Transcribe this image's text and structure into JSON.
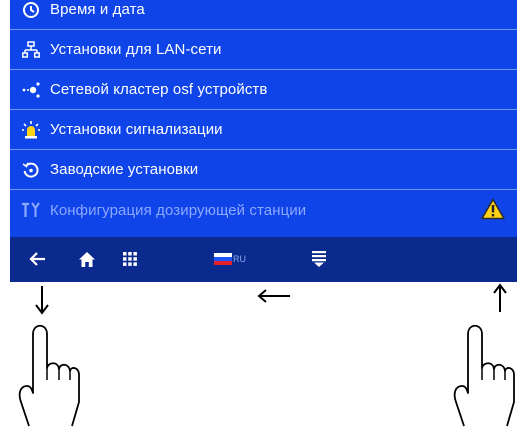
{
  "menu": {
    "items": [
      {
        "label": "Время и дата",
        "icon": "clock-icon"
      },
      {
        "label": "Установки для LAN-сети",
        "icon": "network-icon"
      },
      {
        "label": "Сетевой кластер osf устройств",
        "icon": "cluster-icon"
      },
      {
        "label": "Установки сигнализации",
        "icon": "alarm-light-icon"
      },
      {
        "label": "Заводские установки",
        "icon": "restore-icon"
      },
      {
        "label": "Конфигурация дозирующей станции",
        "icon": "tools-icon",
        "warning_icon": "warning-icon"
      }
    ]
  },
  "bottom_bar": {
    "back": "back-arrow-icon",
    "home": "home-icon",
    "apps": "grid-icon",
    "language_code": "RU",
    "menu": "list-menu-icon"
  },
  "gestures": {
    "left_finger_arrow": "down-arrow-icon",
    "center_arrow": "left-arrow-icon",
    "right_finger_arrow": "up-arrow-icon",
    "hand": "pointing-hand-icon"
  },
  "colors": {
    "screen_bg": "#0f44e8",
    "bar_bg": "#0a2a8e",
    "divider": "#6f93ff",
    "warning": "#ffd21a"
  }
}
